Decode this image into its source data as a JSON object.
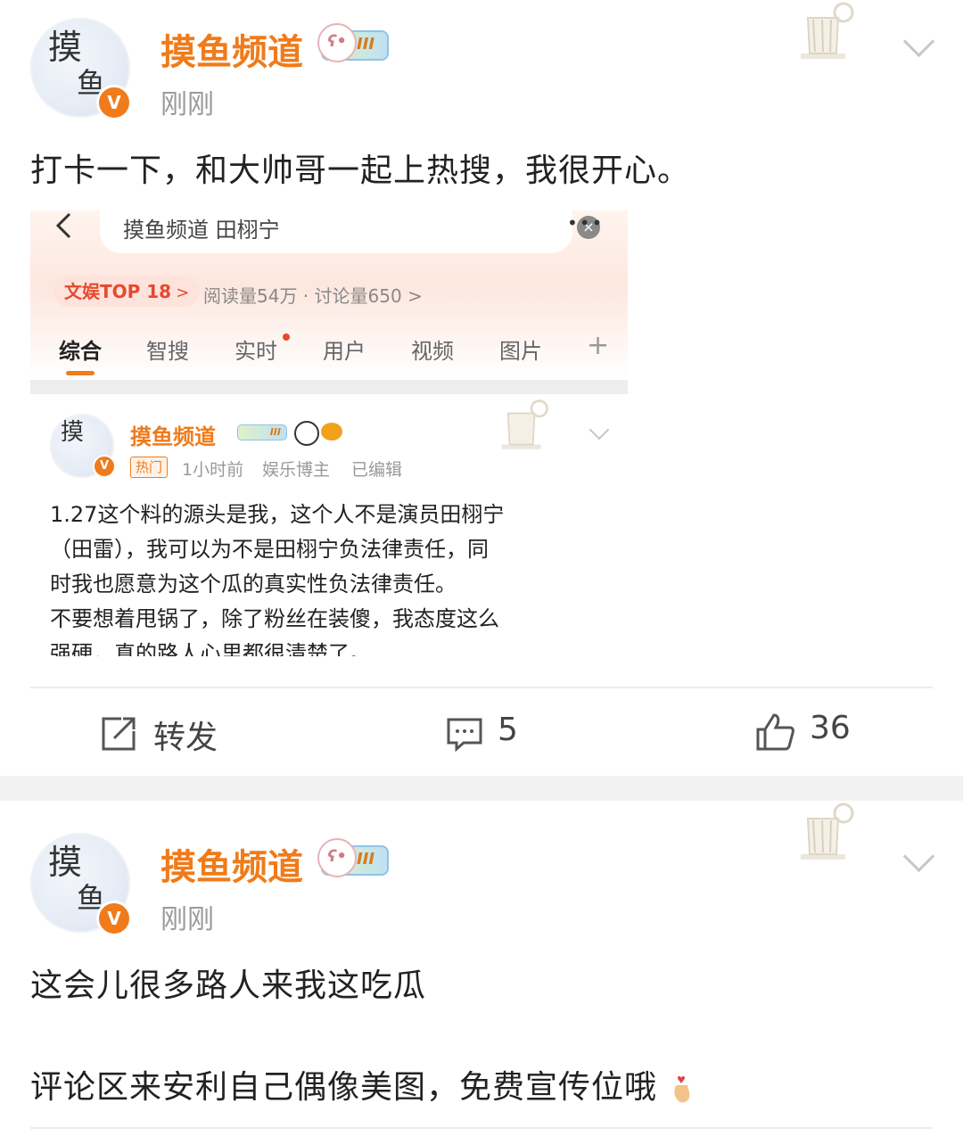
{
  "post1": {
    "author": "摸鱼频道",
    "level_badge": "III",
    "avatar_chars": [
      "摸",
      "鱼"
    ],
    "verified_mark": "V",
    "time": "刚刚",
    "text": "打卡一下，和大帅哥一起上热搜，我很开心。",
    "embed": {
      "search_query": "摸鱼频道 田栩宁",
      "clear_icon": "×",
      "more_icon": "•••",
      "back_icon": "<",
      "rank_badge": "文娱TOP 18",
      "rank_chevron": ">",
      "stats": "阅读量54万 · 讨论量650",
      "stats_chevron": ">",
      "tabs": [
        "综合",
        "智搜",
        "实时",
        "用户",
        "视频",
        "图片",
        "+"
      ],
      "active_tab": "综合",
      "inner_post": {
        "author": "摸鱼频道",
        "level_badge": "III",
        "hot_tag": "热门",
        "time": "1小时前",
        "role": "娱乐博主",
        "edited": "已编辑",
        "lines": [
          "1.27这个料的源头是我，这个人不是演员田栩宁",
          "（田雷），我可以为不是田栩宁负法律责任，同",
          "时我也愿意为这个瓜的真实性负法律责任。",
          "不要想着甩锅了，除了粉丝在装傻，我态度这么",
          "强硬，真的路人心里都很清楚了。"
        ]
      }
    },
    "actions": {
      "repost_label": "转发",
      "comment_count": "5",
      "like_count": "36"
    }
  },
  "post2": {
    "author": "摸鱼频道",
    "level_badge": "III",
    "avatar_chars": [
      "摸",
      "鱼"
    ],
    "verified_mark": "V",
    "time": "刚刚",
    "text_line1": "这会儿很多路人来我这吃瓜",
    "text_line2": "评论区来安利自己偶像美图，免费宣传位哦"
  },
  "colors": {
    "accent": "#f07b1a",
    "rank_red": "#e6492d",
    "separator": "#f2f2f2"
  }
}
